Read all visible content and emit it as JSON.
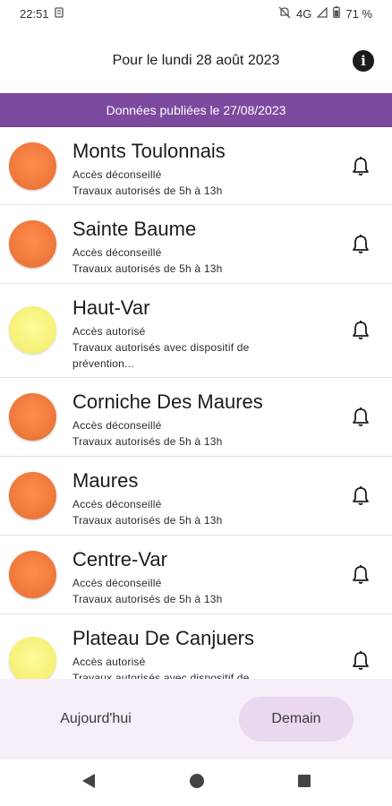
{
  "status_bar": {
    "time": "22:51",
    "network": "4G",
    "battery": "71 %"
  },
  "header": {
    "title": "Pour le lundi 28 août 2023",
    "info_icon": "info-icon"
  },
  "banner": {
    "text": "Données publiées le 27/08/2023"
  },
  "zones": [
    {
      "name": "Monts Toulonnais",
      "status": "Accès déconseillé",
      "works_line1": "Travaux autorisés de 5h à 13h",
      "works_line2": "",
      "level_color": "orange"
    },
    {
      "name": "Sainte Baume",
      "status": "Accès déconseillé",
      "works_line1": "Travaux autorisés de 5h à 13h",
      "works_line2": "",
      "level_color": "orange"
    },
    {
      "name": "Haut-Var",
      "status": "Accès autorisé",
      "works_line1": "Travaux autorisés avec dispositif de",
      "works_line2": "prévention...",
      "level_color": "yellow"
    },
    {
      "name": "Corniche Des Maures",
      "status": "Accès déconseillé",
      "works_line1": "Travaux autorisés de 5h à 13h",
      "works_line2": "",
      "level_color": "orange"
    },
    {
      "name": "Maures",
      "status": "Accès déconseillé",
      "works_line1": "Travaux autorisés de 5h à 13h",
      "works_line2": "",
      "level_color": "orange"
    },
    {
      "name": "Centre-Var",
      "status": "Accès déconseillé",
      "works_line1": "Travaux autorisés de 5h à 13h",
      "works_line2": "",
      "level_color": "orange"
    },
    {
      "name": "Plateau De Canjuers",
      "status": "Accès autorisé",
      "works_line1": "Travaux autorisés avec dispositif de",
      "works_line2": "",
      "level_color": "yellow"
    }
  ],
  "bottom_nav": {
    "today_label": "Aujourd'hui",
    "tomorrow_label": "Demain"
  },
  "colors": {
    "banner": "#7c4a9e",
    "orange_level": "#f07a3c",
    "yellow_level": "#f6f27a",
    "nav_bg": "#f6eef8",
    "nav_selected": "#ead8f0"
  }
}
